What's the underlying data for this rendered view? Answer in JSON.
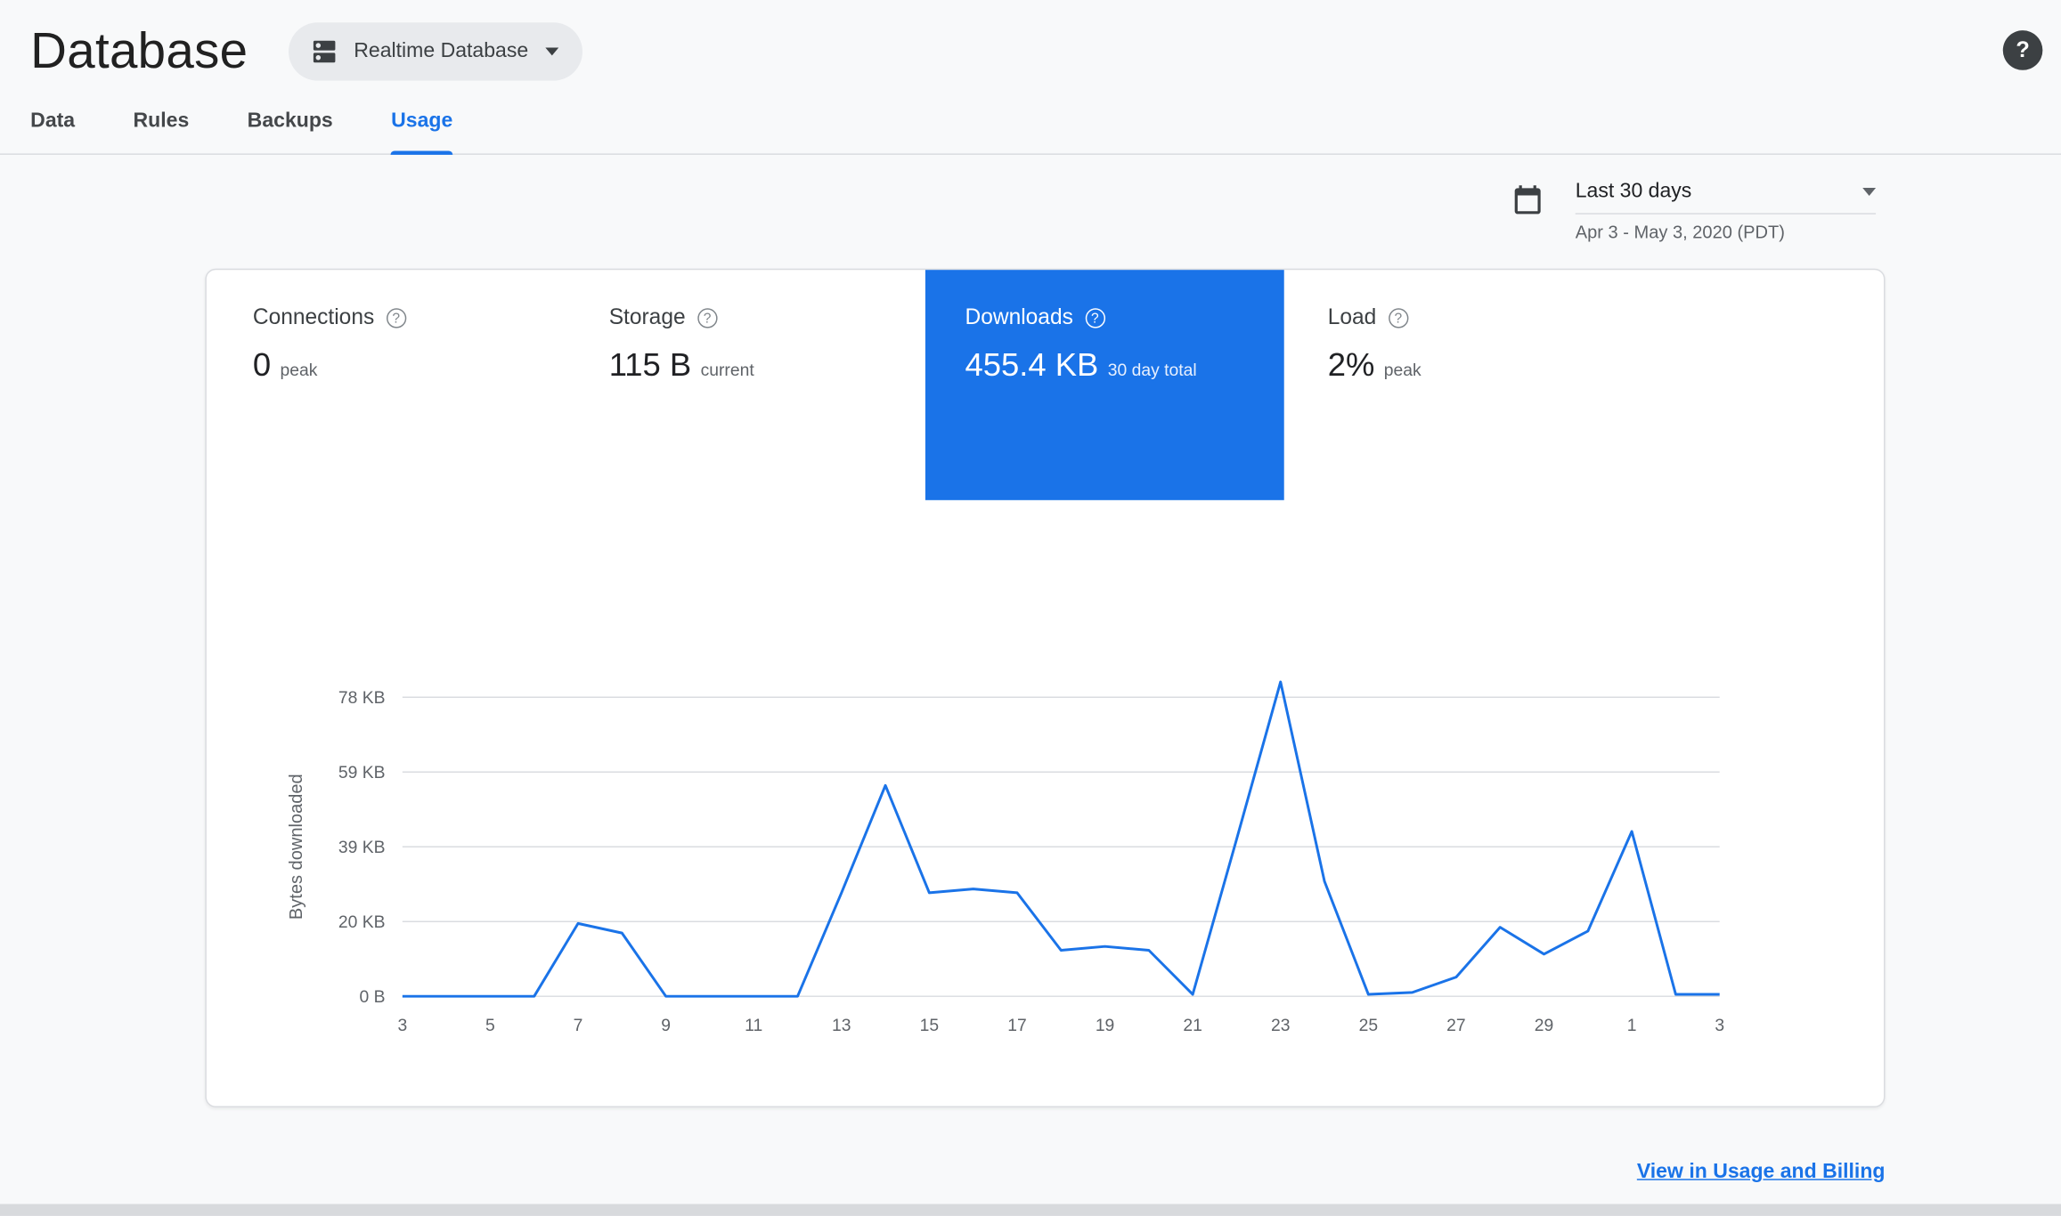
{
  "header": {
    "title": "Database",
    "database_selector": "Realtime Database"
  },
  "icons": {
    "question_mark": "?"
  },
  "tabs": [
    {
      "label": "Data",
      "active": false
    },
    {
      "label": "Rules",
      "active": false
    },
    {
      "label": "Backups",
      "active": false
    },
    {
      "label": "Usage",
      "active": true
    }
  ],
  "date_range": {
    "label": "Last 30 days",
    "caption": "Apr 3 - May 3, 2020 (PDT)"
  },
  "metric_tabs": [
    {
      "title": "Connections",
      "value": "0",
      "unit": "peak",
      "selected": false
    },
    {
      "title": "Storage",
      "value": "115 B",
      "unit": "current",
      "selected": false
    },
    {
      "title": "Downloads",
      "value": "455.4 KB",
      "unit": "30 day total",
      "selected": true
    },
    {
      "title": "Load",
      "value": "2%",
      "unit": "peak",
      "selected": false
    }
  ],
  "chart_data": {
    "type": "line",
    "ylabel": "Bytes downloaded",
    "x_tick_labels": [
      "3",
      "5",
      "7",
      "9",
      "11",
      "13",
      "15",
      "17",
      "19",
      "21",
      "23",
      "25",
      "27",
      "29",
      "1",
      "3"
    ],
    "values_kb": [
      0,
      0,
      0,
      0,
      19,
      16.5,
      0,
      0,
      0,
      0,
      27,
      55,
      27,
      28,
      27,
      12,
      13,
      12,
      0.5,
      41,
      82,
      30,
      0.5,
      1,
      5,
      18,
      11,
      17,
      43,
      0.5,
      0.5
    ],
    "y_ticks": [
      {
        "value": 0,
        "label": "0 B"
      },
      {
        "value": 19.5,
        "label": "20 KB"
      },
      {
        "value": 39,
        "label": "39 KB"
      },
      {
        "value": 58.5,
        "label": "59 KB"
      },
      {
        "value": 78,
        "label": "78 KB"
      }
    ],
    "ylim": [
      0,
      85
    ],
    "grid": true,
    "legend": "none",
    "line_color": "#1a73e8"
  },
  "footer": {
    "link_label": "View in Usage and Billing"
  },
  "colors": {
    "accent_blue": "#1a73e8",
    "selected_metric_bg": "#1a73e8",
    "text_dark": "#202124",
    "text_gray": "#5f6368",
    "gridline": "#dadce0",
    "chip_bg": "#e8eaed",
    "page_bg": "#f8f9fa"
  }
}
